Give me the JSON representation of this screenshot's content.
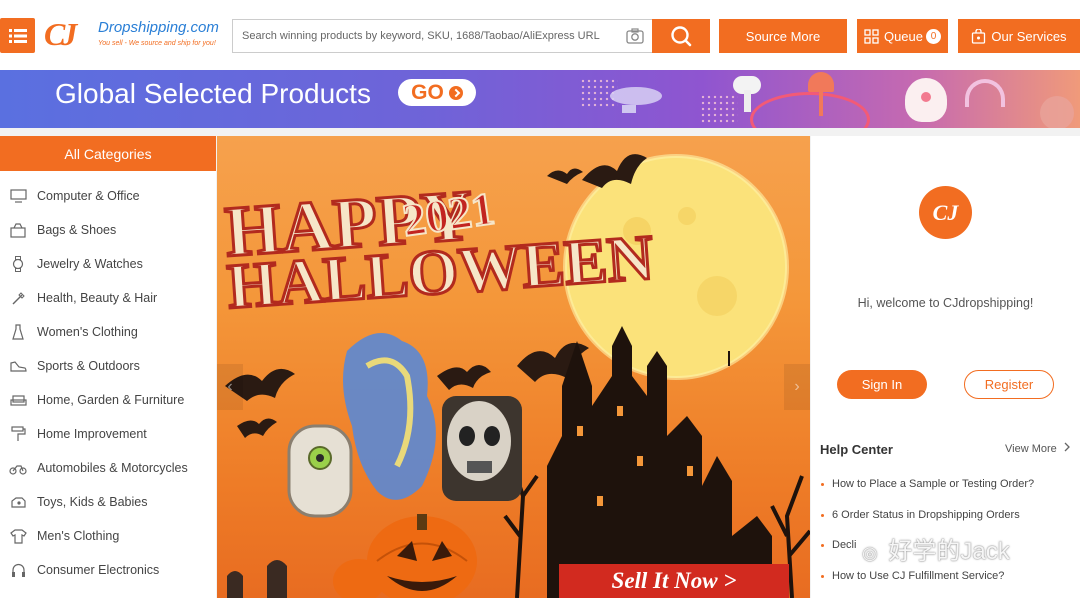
{
  "header": {
    "logo_name": "Dropshipping.com",
    "logo_tagline": "You sell - We source and ship for you!",
    "search_placeholder": "Search winning products by keyword, SKU, 1688/Taobao/AliExpress URL",
    "source_more": "Source More",
    "queue_label": "Queue",
    "queue_count": "0",
    "our_services": "Our Services",
    "brand_color": "#f26d21"
  },
  "promo": {
    "title": "Global Selected Products",
    "go_label": "GO"
  },
  "categories": {
    "heading": "All Categories",
    "items": [
      {
        "label": "Computer & Office",
        "icon": "monitor-icon"
      },
      {
        "label": "Bags & Shoes",
        "icon": "bag-icon"
      },
      {
        "label": "Jewelry & Watches",
        "icon": "watch-icon"
      },
      {
        "label": "Health, Beauty & Hair",
        "icon": "brush-icon"
      },
      {
        "label": "Women's Clothing",
        "icon": "dress-icon"
      },
      {
        "label": "Sports & Outdoors",
        "icon": "shoe-icon"
      },
      {
        "label": "Home, Garden & Furniture",
        "icon": "sofa-icon"
      },
      {
        "label": "Home Improvement",
        "icon": "paint-roller-icon"
      },
      {
        "label": "Automobiles & Motorcycles",
        "icon": "motorcycle-icon"
      },
      {
        "label": "Toys, Kids & Babies",
        "icon": "toy-icon"
      },
      {
        "label": "Men's Clothing",
        "icon": "shirt-icon"
      },
      {
        "label": "Consumer Electronics",
        "icon": "headphones-icon"
      }
    ]
  },
  "hero": {
    "headline_1": "HAPPY",
    "year": "2021",
    "headline_2": "HALLOWEEN",
    "cta": "Sell It Now >"
  },
  "account": {
    "avatar_text": "CJ",
    "welcome": "Hi, welcome to CJdropshipping!",
    "sign_in": "Sign In",
    "register": "Register"
  },
  "help": {
    "title": "Help Center",
    "view_more": "View More",
    "items": [
      "How to Place a Sample or Testing Order?",
      "6 Order Status in Dropshipping Orders",
      "Decli",
      "How to Use CJ Fulfillment Service?"
    ]
  },
  "watermark": "好学的Jack"
}
